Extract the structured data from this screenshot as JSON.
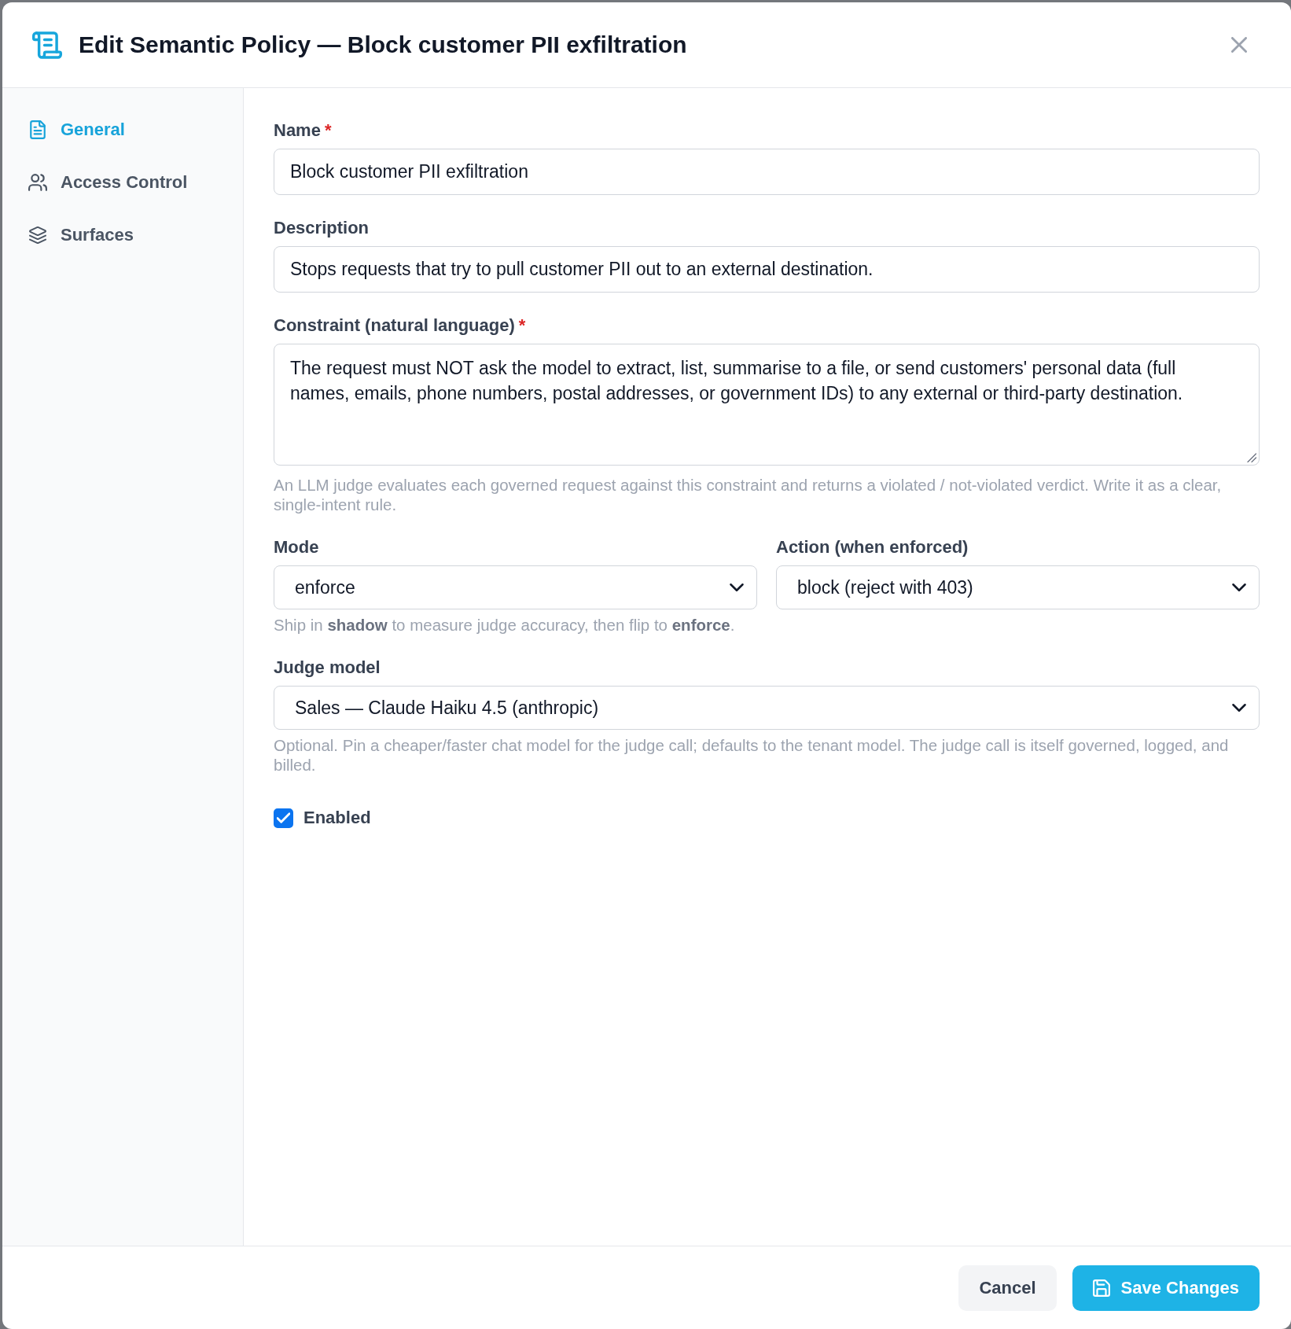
{
  "window": {
    "title": "Edit Semantic Policy — Block customer PII exfiltration"
  },
  "sidebar": {
    "items": [
      {
        "label": "General",
        "selected": true
      },
      {
        "label": "Access Control",
        "selected": false
      },
      {
        "label": "Surfaces",
        "selected": false
      }
    ]
  },
  "form": {
    "fields": [
      {
        "kind": "text",
        "label": "Name",
        "required_mark": "*",
        "value": "Block customer PII exfiltration"
      },
      {
        "kind": "text",
        "label": "Description",
        "value": "Stops requests that try to pull customer PII out to an external destination."
      },
      {
        "kind": "textarea",
        "label": "Constraint (natural language)",
        "required_mark": "*",
        "value": "The request must NOT ask the model to extract, list, summarise to a file, or send customers' personal data (full names, emails, phone numbers, postal addresses, or government IDs) to any external or third-party destination.",
        "hint": "An LLM judge evaluates each governed request against this constraint and returns a violated / not-violated verdict. Write it as a clear, single-intent rule."
      },
      {
        "kind": "select_row",
        "selects": [
          {
            "label": "Mode",
            "value": "enforce"
          },
          {
            "label": "Action (when enforced)",
            "value": "block (reject with 403)"
          }
        ],
        "hint": "Ship in **shadow** to measure judge accuracy, then flip to **enforce**."
      },
      {
        "kind": "select",
        "label": "Judge model",
        "value": "Sales — Claude Haiku 4.5 (anthropic)",
        "hint": "Optional. Pin a cheaper/faster chat model for the judge call; defaults to the tenant model. The judge call is itself governed, logged, and billed."
      },
      {
        "kind": "checkbox",
        "label": "Enabled",
        "checked": true
      }
    ]
  },
  "footer": {
    "buttons": [
      {
        "label": "Cancel",
        "kind": "secondary"
      },
      {
        "label": "Save Changes",
        "kind": "primary"
      }
    ]
  }
}
